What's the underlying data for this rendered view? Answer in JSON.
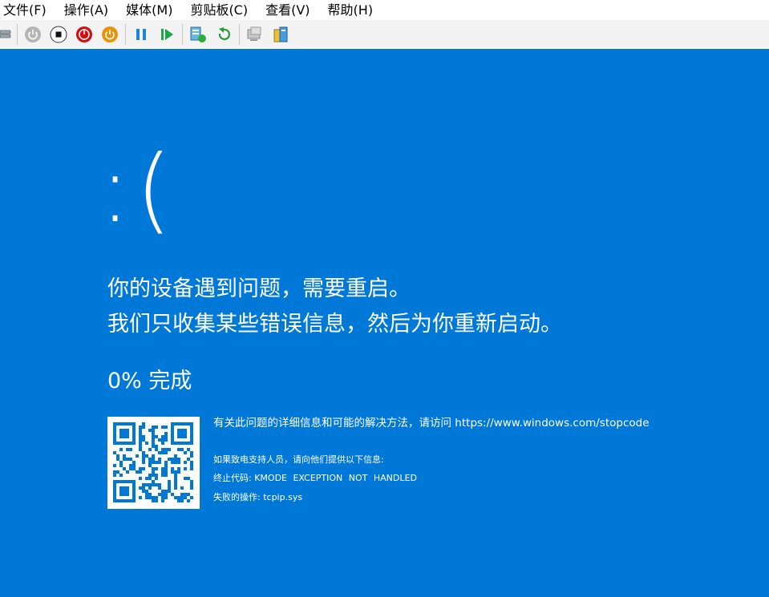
{
  "menu": [
    {
      "label": "文件(F)"
    },
    {
      "label": "操作(A)"
    },
    {
      "label": "媒体(M)"
    },
    {
      "label": "剪贴板(C)"
    },
    {
      "label": "查看(V)"
    },
    {
      "label": "帮助(H)"
    }
  ],
  "toolbar": {
    "icons": [
      "ctrl-alt-del-icon",
      "start-icon",
      "turn-off-icon",
      "shutdown-icon",
      "save-icon",
      "pause-icon",
      "resume-icon",
      "checkpoint-icon",
      "revert-icon",
      "enhanced-session-icon",
      "share-icon"
    ]
  },
  "bsod": {
    "sad_face": ":(",
    "line1": "你的设备遇到问题，需要重启。",
    "line2": "我们只收集某些错误信息，然后为你重新启动。",
    "progress_text": "0% 完成",
    "progress_percent": 0,
    "info_prefix": "有关此问题的详细信息和可能的解决方法，请访问 ",
    "info_url": "https://www.windows.com/stopcode",
    "support_text": "如果致电支持人员，请向他们提供以下信息:",
    "stop_code_label": "终止代码: ",
    "stop_code": "KMODE EXCEPTION NOT HANDLED",
    "failed_label": "失败的操作: ",
    "failed_module": "tcpip.sys",
    "background_color": "#0078d7"
  }
}
